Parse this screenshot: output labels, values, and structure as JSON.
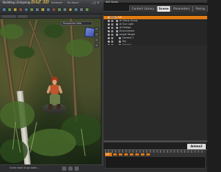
{
  "left_app": {
    "title": "Building | Eclipsing",
    "brand": "DAZ 3D",
    "menus": [
      "Hardware",
      "My Brand"
    ],
    "window_controls": "_ □ ×",
    "viewport_label": "Perspective View",
    "status_text": "Scroll down to go down..."
  },
  "right_app": {
    "title": "DAZ Studio",
    "tabs": [
      {
        "label": "Content Library",
        "active": false
      },
      {
        "label": "Scene",
        "active": true
      },
      {
        "label": "Parameters",
        "active": false
      },
      {
        "label": "Posing",
        "active": false
      }
    ],
    "scene_items": [
      {
        "label": "Lar",
        "selected": true,
        "indent": 0
      },
      {
        "label": "Ai Group Group",
        "selected": false,
        "indent": 1
      },
      {
        "label": "Ai Sun Light",
        "selected": false,
        "indent": 1
      },
      {
        "label": "AI Foliage",
        "selected": false,
        "indent": 1
      },
      {
        "label": "Environment",
        "selected": false,
        "indent": 1
      },
      {
        "label": "Jungle Tangle",
        "selected": false,
        "indent": 1
      },
      {
        "label": "Camera 1",
        "selected": false,
        "indent": 2
      },
      {
        "label": "Sky",
        "selected": false,
        "indent": 2
      },
      {
        "label": "Ground",
        "selected": false,
        "indent": 2
      }
    ],
    "timeline_tab": "Anima2",
    "timeline_row": "Lar",
    "accent_color": "#e07b12"
  }
}
